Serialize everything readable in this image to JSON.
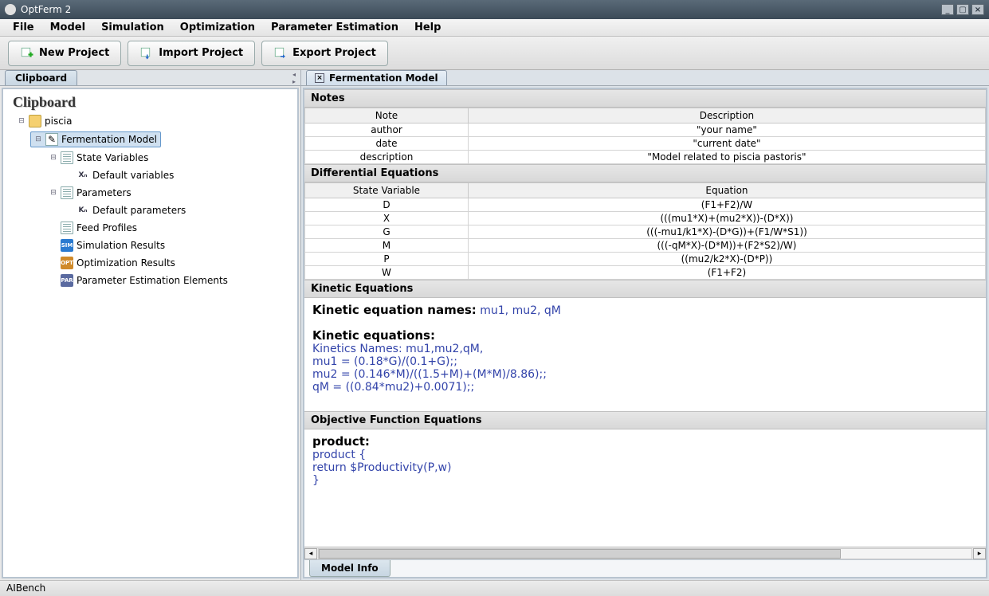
{
  "window": {
    "title": "OptFerm 2"
  },
  "menu": {
    "items": [
      "File",
      "Model",
      "Simulation",
      "Optimization",
      "Parameter Estimation",
      "Help"
    ]
  },
  "toolbar": {
    "new_project": "New Project",
    "import_project": "Import Project",
    "export_project": "Export Project"
  },
  "left": {
    "tab": "Clipboard",
    "header": "Clipboard",
    "tree": {
      "project": "piscia",
      "model": "Fermentation Model",
      "state_vars": "State Variables",
      "default_vars": "Default variables",
      "params": "Parameters",
      "default_params": "Default parameters",
      "feed": "Feed Profiles",
      "sim_results": "Simulation Results",
      "opt_results": "Optimization Results",
      "param_est": "Parameter Estimation Elements"
    }
  },
  "right": {
    "tab": "Fermentation Model",
    "notes": {
      "title": "Notes",
      "head_note": "Note",
      "head_desc": "Description",
      "rows": [
        {
          "note": "author",
          "desc": "\"your name\""
        },
        {
          "note": "date",
          "desc": "\"current date\""
        },
        {
          "note": "description",
          "desc": "\"Model related to piscia pastoris\""
        }
      ]
    },
    "diff": {
      "title": "Differential Equations",
      "head_var": "State Variable",
      "head_eq": "Equation",
      "rows": [
        {
          "v": "D",
          "e": "(F1+F2)/W"
        },
        {
          "v": "X",
          "e": "(((mu1*X)+(mu2*X))-(D*X))"
        },
        {
          "v": "G",
          "e": "(((-mu1/k1*X)-(D*G))+(F1/W*S1))"
        },
        {
          "v": "M",
          "e": "(((-qM*X)-(D*M))+(F2*S2)/W)"
        },
        {
          "v": "P",
          "e": "((mu2/k2*X)-(D*P))"
        },
        {
          "v": "W",
          "e": "(F1+F2)"
        }
      ]
    },
    "kin": {
      "title": "Kinetic Equations",
      "names_label": "Kinetic equation names:",
      "names_val": "mu1, mu2, qM",
      "eq_label": "Kinetic equations:",
      "lines": [
        "Kinetics Names: mu1,mu2,qM,",
        "mu1 = (0.18*G)/(0.1+G);;",
        "mu2 = (0.146*M)/((1.5+M)+(M*M)/8.86);;",
        "qM = ((0.84*mu2)+0.0071);;"
      ]
    },
    "obj": {
      "title": "Objective Function Equations",
      "label": "product:",
      "lines": [
        "product    {",
        "return $Productivity(P,w)",
        "}"
      ]
    },
    "bottom_tab": "Model Info"
  },
  "status": "AIBench"
}
